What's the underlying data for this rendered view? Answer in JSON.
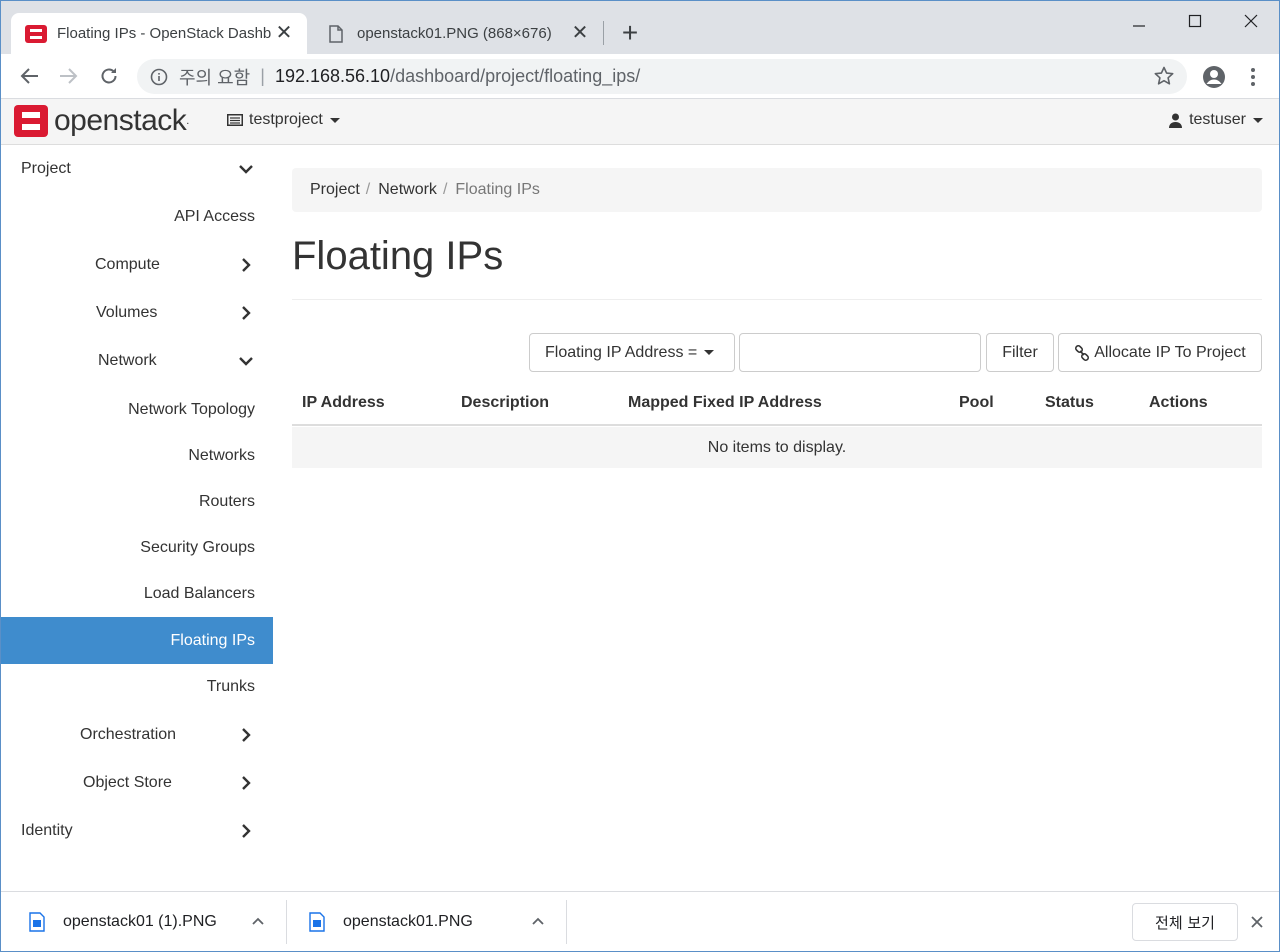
{
  "browser": {
    "tabs": [
      {
        "title": "Floating IPs - OpenStack Dashboard",
        "active": true
      },
      {
        "title": "openstack01.PNG (868×676)",
        "active": false
      }
    ],
    "address": {
      "security_label": "주의 요함",
      "separator": "|",
      "host": "192.168.56.10",
      "path": "/dashboard/project/floating_ips/"
    }
  },
  "header": {
    "logo_text": "openstack",
    "logo_mark": ".",
    "project": "testproject",
    "user": "testuser"
  },
  "sidebar": {
    "items": [
      {
        "label": "Project",
        "chevron": "down"
      },
      {
        "label": "API Access"
      },
      {
        "label": "Compute",
        "chevron": "right"
      },
      {
        "label": "Volumes",
        "chevron": "right"
      },
      {
        "label": "Network",
        "chevron": "down"
      },
      {
        "label": "Network Topology"
      },
      {
        "label": "Networks"
      },
      {
        "label": "Routers"
      },
      {
        "label": "Security Groups"
      },
      {
        "label": "Load Balancers"
      },
      {
        "label": "Floating IPs",
        "active": true
      },
      {
        "label": "Trunks"
      },
      {
        "label": "Orchestration",
        "chevron": "right"
      },
      {
        "label": "Object Store",
        "chevron": "right"
      },
      {
        "label": "Identity",
        "chevron": "right"
      }
    ]
  },
  "breadcrumb": {
    "items": [
      "Project",
      "Network",
      "Floating IPs"
    ],
    "separator": "/"
  },
  "page": {
    "title": "Floating IPs"
  },
  "filter": {
    "field_label": "Floating IP Address =",
    "value": "",
    "button": "Filter",
    "allocate_button": "Allocate IP To Project"
  },
  "table": {
    "columns": [
      "IP Address",
      "Description",
      "Mapped Fixed IP Address",
      "Pool",
      "Status",
      "Actions"
    ],
    "empty_message": "No items to display."
  },
  "downloads": {
    "items": [
      "openstack01 (1).PNG",
      "openstack01.PNG"
    ],
    "show_all": "전체 보기"
  },
  "colors": {
    "accent": "#3f8ccd",
    "logo_red": "#da1a32"
  }
}
